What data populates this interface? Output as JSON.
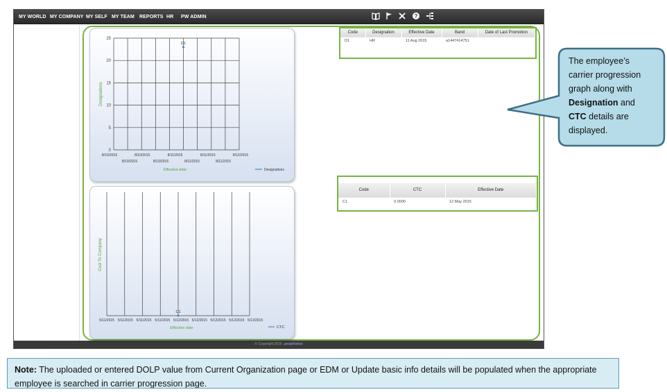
{
  "navbar": {
    "items": [
      "MY WORLD",
      "MY COMPANY",
      "MY SELF",
      "MY TEAM",
      "REPORTS",
      "HR",
      "PW ADMIN"
    ],
    "icons": [
      "book-icon",
      "flag-icon",
      "tools-icon",
      "help-icon",
      "sitemap-icon"
    ]
  },
  "designation_chart": {
    "chart_data": {
      "type": "line",
      "ylabel": "Designations",
      "xlabel": "Effective date",
      "ylim": [
        0,
        25
      ],
      "yticks": [
        0,
        5,
        10,
        15,
        20,
        25
      ],
      "xticks_top": [
        "8/10/2015",
        "8/10/2015",
        "8/11/2015",
        "8/11/2015",
        "8/12/2015"
      ],
      "xticks_bottom": [
        "8/10/2015",
        "8/10/2015",
        "8/11/2015",
        "8/11/2015"
      ],
      "series": [
        {
          "name": "Designations",
          "points": [
            {
              "x": "8/11/2015",
              "y": 23,
              "label": "D1"
            }
          ]
        }
      ],
      "legend": "bottom-right",
      "grid": true
    }
  },
  "ctc_chart": {
    "chart_data": {
      "type": "line",
      "ylabel": "Cost To Company",
      "xlabel": "Effective date",
      "xticks": [
        "5/11/2015",
        "5/11/2015",
        "5/11/2015",
        "5/11/2015",
        "5/12/2015",
        "5/12/2015",
        "5/12/2015",
        "5/12/2015",
        "5/13/2015"
      ],
      "series": [
        {
          "name": "CTC",
          "points": [
            {
              "x": "5/12/2015",
              "y": 0.0,
              "label": "C1"
            }
          ]
        }
      ],
      "legend": "bottom-right",
      "grid": true
    }
  },
  "designation_table": {
    "headers": [
      "Code",
      "Designation",
      "Effective Date",
      "Band",
      "Date of Last Promotion"
    ],
    "rows": [
      [
        "D1",
        "HR",
        "11 Aug 2015",
        "a1447414751",
        ""
      ]
    ]
  },
  "ctc_table": {
    "headers": [
      "Code",
      "CTC",
      "Effective Date"
    ],
    "rows": [
      [
        "C1",
        "0.0000",
        "12 May 2015"
      ]
    ]
  },
  "callout": {
    "line1": "The employee’s",
    "line2": "carrier progression",
    "line3": "graph along with",
    "designation_word": "Designation",
    "and_word": " and",
    "ctc_word": "CTC",
    "line5_rest": " details are",
    "line6": "displayed."
  },
  "footer": {
    "copyright": "© Copyright 2015",
    "brand": "peoplewise"
  },
  "note": {
    "label": "Note:",
    "text": " The uploaded or entered DOLP value from Current Organization page or EDM or Update basic info details will be populated when the appropriate employee is searched in carrier progression page."
  },
  "colors": {
    "accent_green": "#77b342",
    "series_blue": "#4a86c8",
    "callout_fill": "#b5dce8",
    "callout_border": "#3d6f86"
  }
}
